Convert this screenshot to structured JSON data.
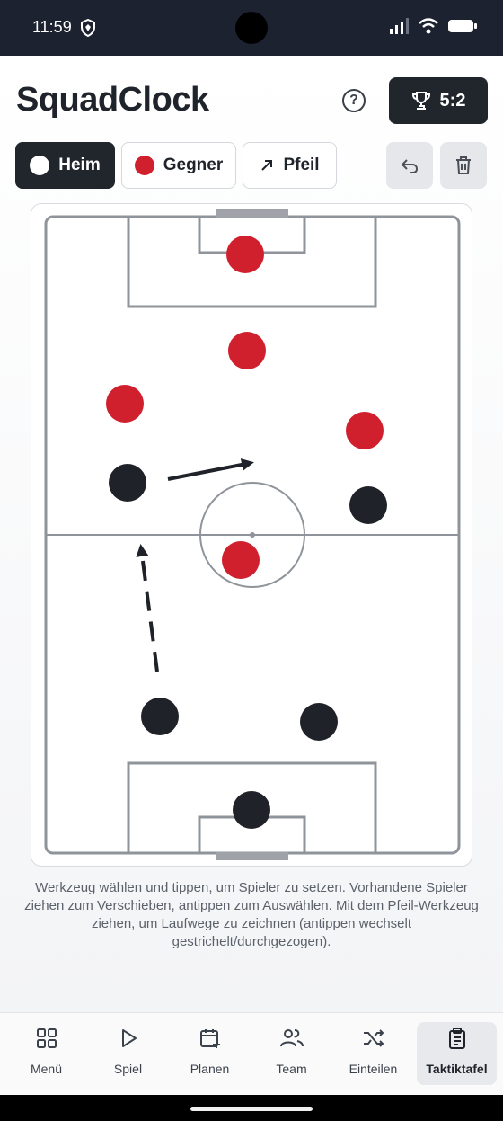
{
  "status": {
    "time": "11:59"
  },
  "app": {
    "title": "SquadClock",
    "score": "5:2"
  },
  "tools": {
    "home": {
      "label": "Heim",
      "color": "#ffffff"
    },
    "opponent": {
      "label": "Gegner",
      "color": "#d0202e"
    },
    "arrow": {
      "label": "Pfeil"
    }
  },
  "colors": {
    "home_player": "#1f2228",
    "opponent_player": "#d0202e",
    "pitch_line": "#8f949b"
  },
  "hint": "Werkzeug wählen und tippen, um Spieler zu setzen. Vorhandene Spieler ziehen zum Verschieben, antippen zum Auswählen. Mit dem Pfeil-Werkzeug ziehen, um Laufwege zu zeichnen (antippen wechselt gestrichelt/durchgezogen).",
  "tabs": [
    {
      "label": "Menü",
      "icon": "grid-icon"
    },
    {
      "label": "Spiel",
      "icon": "play-icon"
    },
    {
      "label": "Planen",
      "icon": "calendar-plus-icon"
    },
    {
      "label": "Team",
      "icon": "users-icon"
    },
    {
      "label": "Einteilen",
      "icon": "shuffle-icon"
    },
    {
      "label": "Taktiktafel",
      "icon": "clipboard-icon"
    }
  ]
}
